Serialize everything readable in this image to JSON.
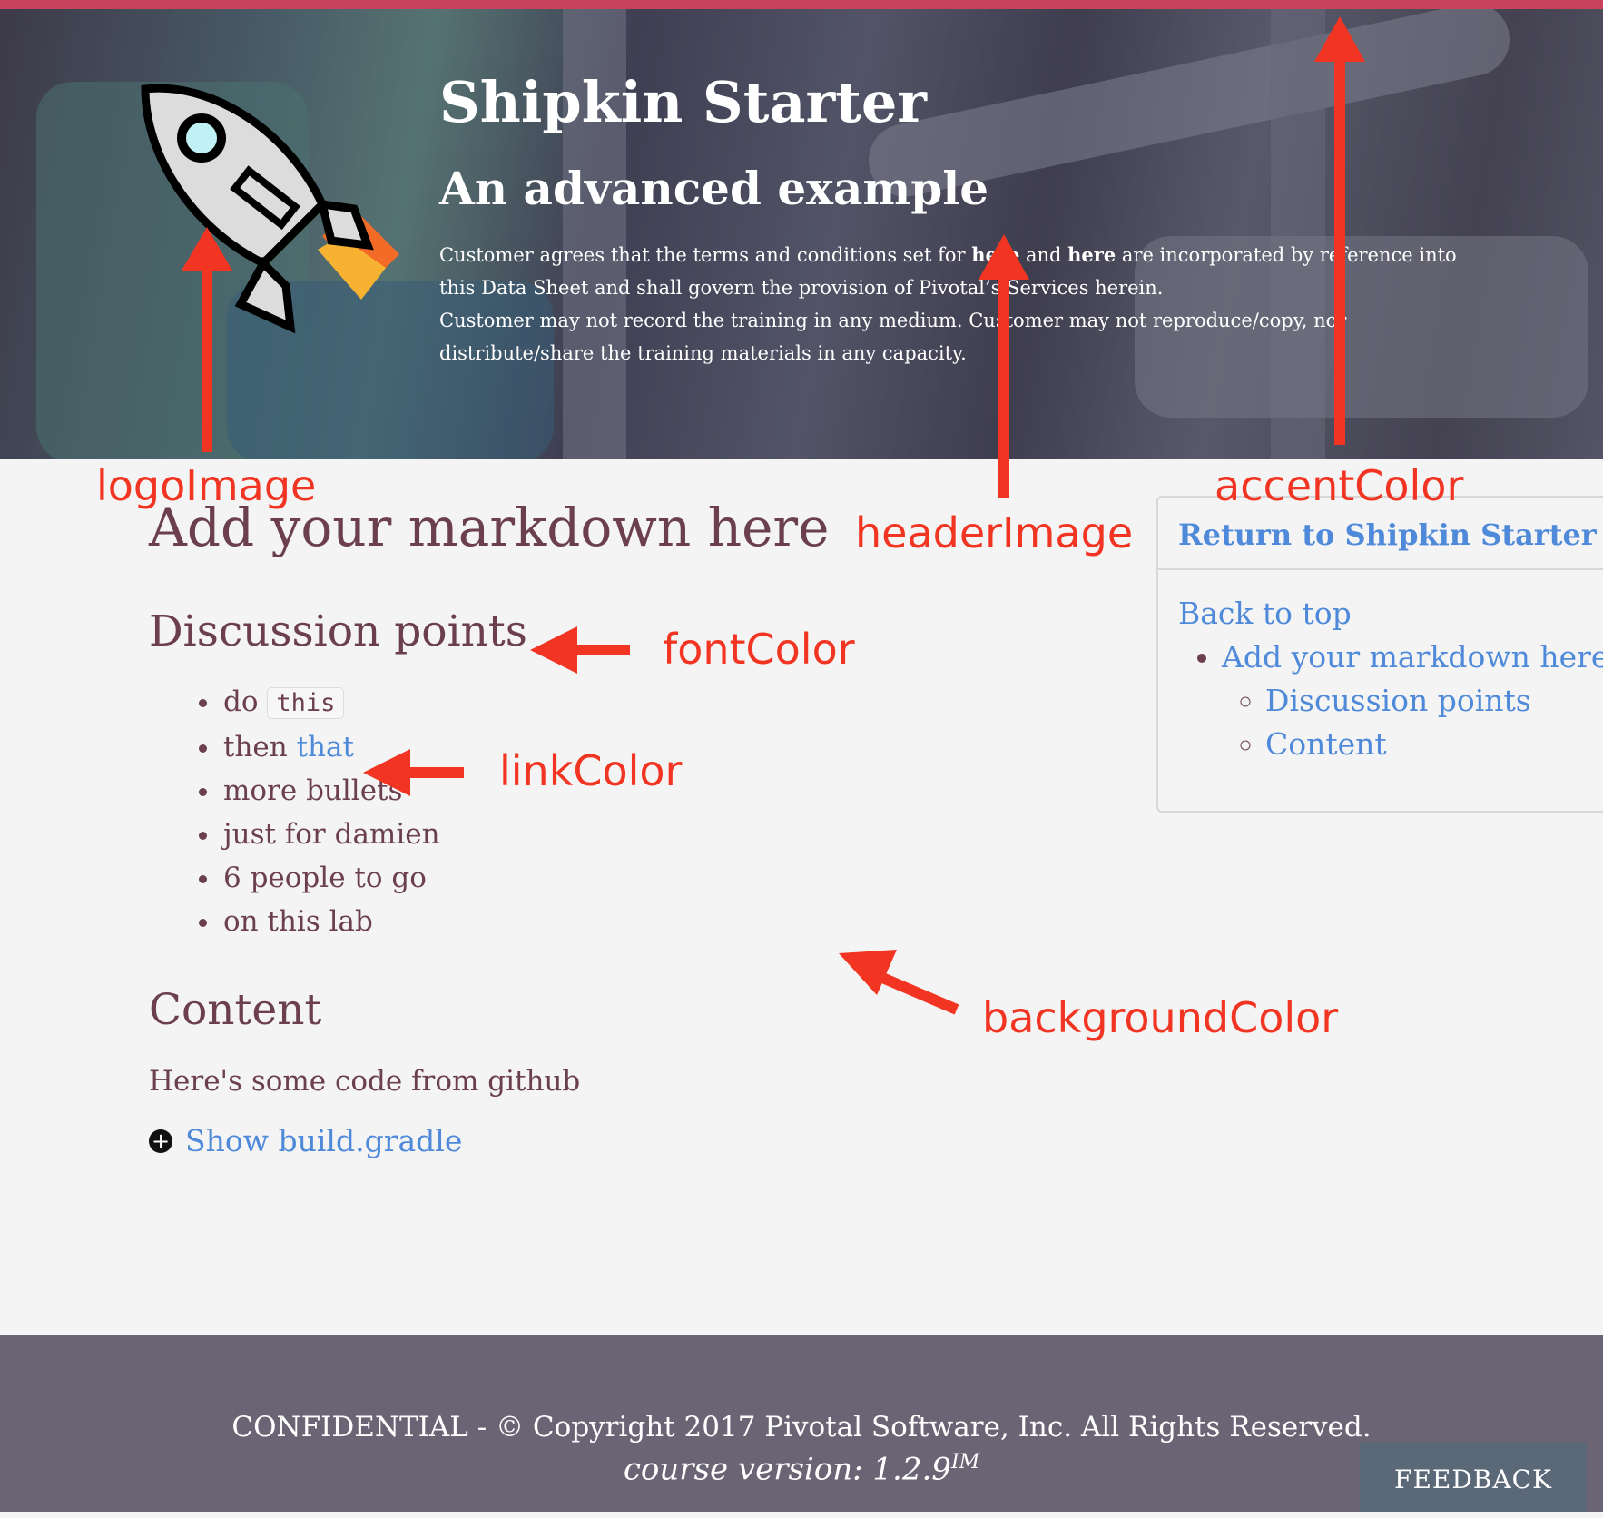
{
  "header": {
    "title": "Shipkin Starter",
    "subtitle": "An advanced example",
    "disclaimer_part1": "Customer agrees that the terms and conditions set for",
    "disclaimer_link1": "here",
    "disclaimer_part2": " and ",
    "disclaimer_link2": "here",
    "disclaimer_part3": " are incorporated by reference into this Data Sheet and shall govern the provision of Pivotal’s Services herein.",
    "disclaimer_line2": "Customer may not record the training in any medium. Customer may not reproduce/copy, nor distribute/share the training materials in any capacity.",
    "logo": "rocket-icon"
  },
  "main": {
    "heading": "Add your markdown here",
    "discussion_heading": "Discussion points",
    "bullet1_text": "do",
    "bullet1_code": "this",
    "bullet2_text": "then",
    "bullet2_link": "that",
    "bullets_rest": [
      "more bullets",
      "just for damien",
      "6 people to go",
      "on this lab"
    ],
    "content_heading": "Content",
    "content_text": "Here's some code from github",
    "show_code_link": "Show build.gradle",
    "show_code_icon": "plus-circle-icon"
  },
  "toc": {
    "return_link": "Return to Shipkin Starter",
    "back_to_top": "Back to top",
    "items": [
      {
        "label": "Add your markdown here"
      },
      {
        "label": "Discussion points"
      },
      {
        "label": "Content"
      }
    ]
  },
  "annotations": {
    "logo_image": "logoImage",
    "header_image": "headerImage",
    "accent_color": "accentColor",
    "font_color": "fontColor",
    "link_color": "linkColor",
    "background_color": "backgroundColor"
  },
  "footer": {
    "copyright": "CONFIDENTIAL - © Copyright 2017 Pivotal Software, Inc. All Rights Reserved.",
    "version_label": "course version: 1.2.9",
    "version_sup": "IM",
    "feedback": "FEEDBACK"
  },
  "colors": {
    "accent": "#c8415d",
    "font": "#6b3f4e",
    "link": "#4f89d9",
    "background": "#f4f4f4",
    "annotation": "#f23522",
    "footer": "#6a6474"
  }
}
